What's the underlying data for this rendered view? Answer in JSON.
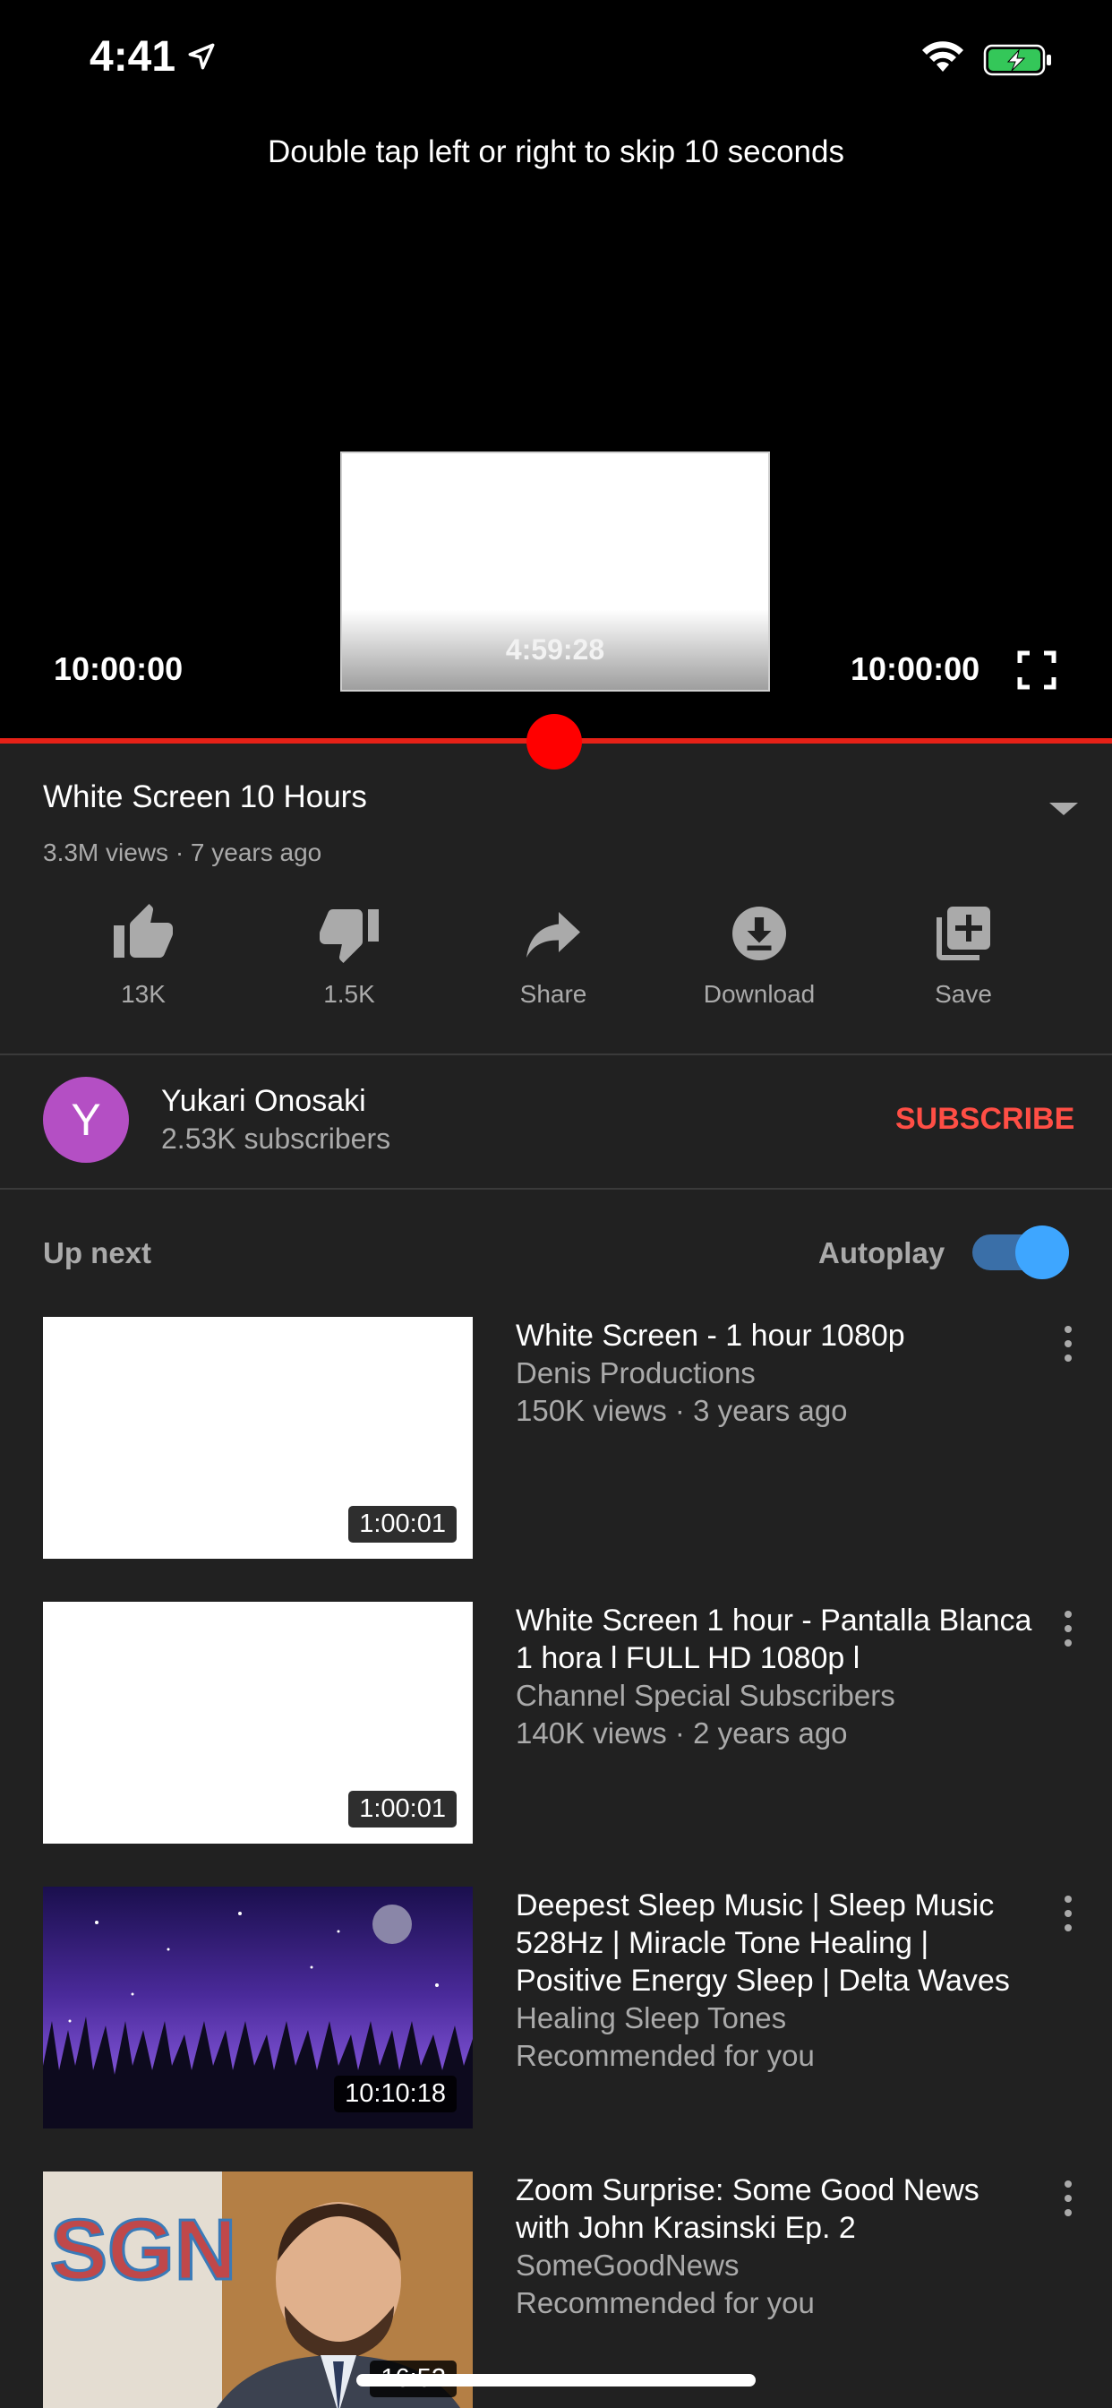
{
  "status_bar": {
    "time": "4:41",
    "location_icon": "location-arrow-icon",
    "wifi_icon": "wifi-icon",
    "battery_icon": "battery-charging-icon"
  },
  "player": {
    "hint": "Double tap left or right to skip 10 seconds",
    "preview_time": "4:59:28",
    "current_time": "10:00:00",
    "total_time": "10:00:00",
    "progress_fraction": 0.5,
    "accent_color": "#ff0000"
  },
  "video": {
    "title": "White Screen 10 Hours",
    "meta": "3.3M views · 7 years ago"
  },
  "actions": [
    {
      "icon": "thumbs-up-icon",
      "label": "13K"
    },
    {
      "icon": "thumbs-down-icon",
      "label": "1.5K"
    },
    {
      "icon": "share-icon",
      "label": "Share"
    },
    {
      "icon": "download-icon",
      "label": "Download"
    },
    {
      "icon": "save-playlist-icon",
      "label": "Save"
    }
  ],
  "channel": {
    "avatar_letter": "Y",
    "avatar_color": "#b44fc4",
    "name": "Yukari Onosaki",
    "subscribers": "2.53K subscribers",
    "subscribe_label": "SUBSCRIBE"
  },
  "up_next": {
    "label": "Up next",
    "autoplay_label": "Autoplay",
    "autoplay_on": true,
    "videos": [
      {
        "title": "White Screen - 1 hour 1080p",
        "channel": "Denis Productions",
        "info": "150K views · 3 years ago",
        "duration": "1:00:01",
        "thumbnail": "white"
      },
      {
        "title": "White Screen 1 hour - Pantalla Blanca 1 hora l FULL HD 1080p l",
        "channel": "Channel Special Subscribers",
        "info": "140K views · 2 years ago",
        "duration": "1:00:01",
        "thumbnail": "white"
      },
      {
        "title": "Deepest Sleep Music | Sleep Music 528Hz | Miracle Tone Healing | Positive Energy Sleep | Delta Waves",
        "channel": "Healing Sleep Tones",
        "info": "Recommended for you",
        "duration": "10:10:18",
        "thumbnail": "night-sky"
      },
      {
        "title": "Zoom Surprise: Some Good News with John Krasinski Ep. 2",
        "channel": "SomeGoodNews",
        "info": "Recommended for you",
        "duration": "16:52",
        "thumbnail": "sgn-portrait",
        "thumb_sign": "SGN"
      }
    ]
  }
}
